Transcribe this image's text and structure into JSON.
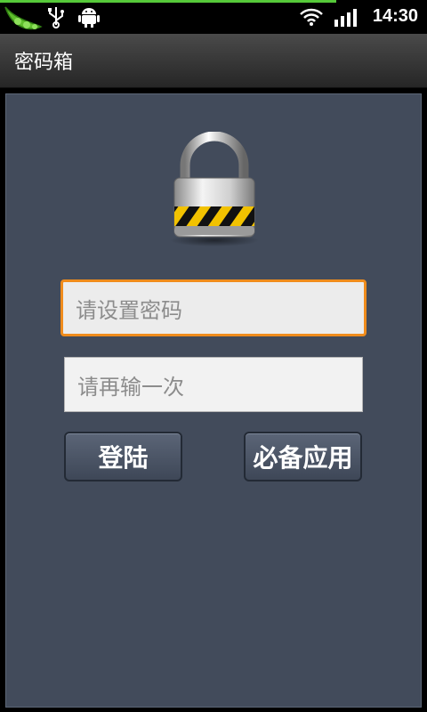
{
  "status_bar": {
    "time": "14:30"
  },
  "title_bar": {
    "title": "密码箱"
  },
  "form": {
    "password_placeholder": "请设置密码",
    "confirm_placeholder": "请再输一次"
  },
  "buttons": {
    "login": "登陆",
    "essential_apps": "必备应用"
  },
  "colors": {
    "panel": "#424b5b",
    "focus_border": "#f08c1c",
    "accent_green": "#56c93a"
  }
}
